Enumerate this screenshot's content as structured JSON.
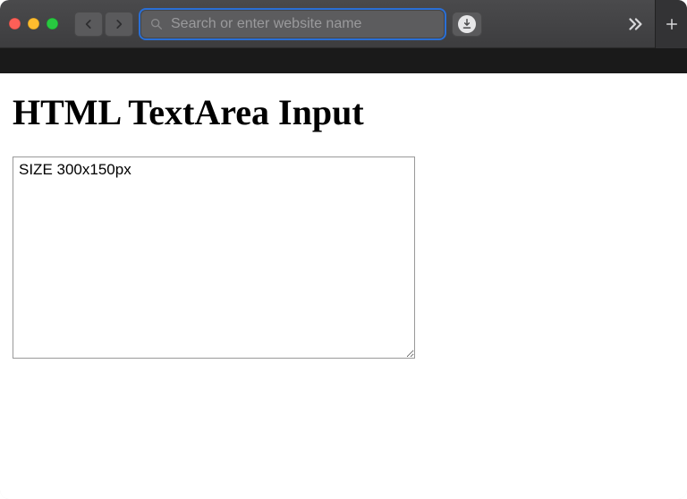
{
  "toolbar": {
    "search_placeholder": "Search or enter website name"
  },
  "page": {
    "heading": "HTML TextArea Input",
    "textarea_value": "SIZE 300x150px"
  }
}
